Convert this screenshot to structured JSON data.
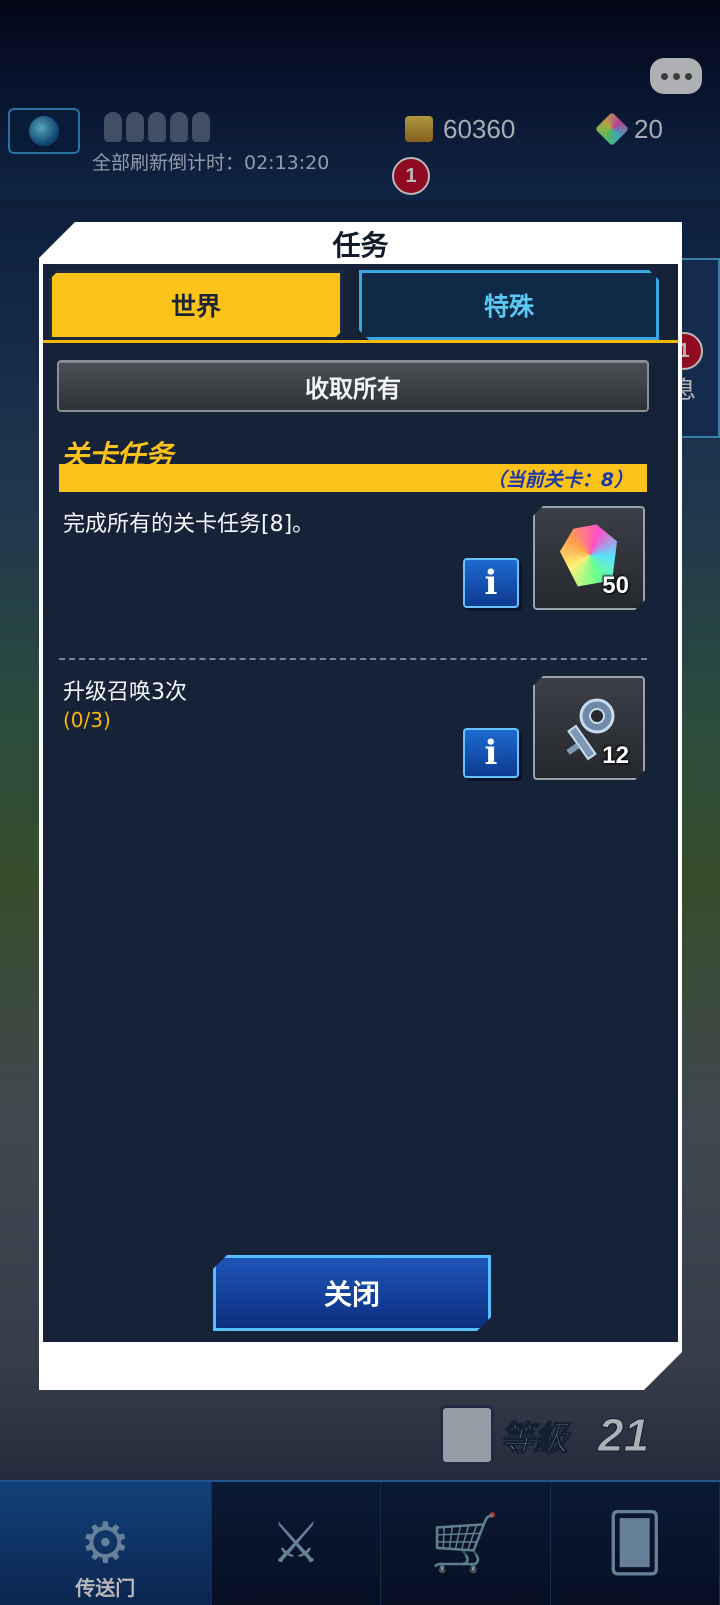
{
  "header": {
    "refresh_countdown": "全部刷新倒计时：02:13:20",
    "gold": "60360",
    "gems": "20",
    "notification_badge": "1",
    "side_badge": "1",
    "side_label": "息"
  },
  "modal": {
    "title": "任务",
    "tabs": [
      {
        "label": "世界",
        "active": true
      },
      {
        "label": "特殊",
        "active": false
      }
    ],
    "collect_all_label": "收取所有",
    "section": {
      "heading": "关卡任务",
      "current_stage": "（当前关卡：8）"
    },
    "quests": [
      {
        "title": "完成所有的关卡任务[8]。",
        "progress": "",
        "reward_icon": "rainbow-gem-icon",
        "reward_count": "50"
      },
      {
        "title": "升级召唤3次",
        "progress": "(0/3)",
        "reward_icon": "key-icon",
        "reward_count": "12"
      }
    ],
    "info_label": "i",
    "close_label": "关闭"
  },
  "hud": {
    "level_label": "等級",
    "level_value": "21"
  },
  "bottom_nav": [
    {
      "label": "传送门",
      "icon": "portal-icon"
    },
    {
      "label": "",
      "icon": "duel-swords-icon"
    },
    {
      "label": "",
      "icon": "shop-cart-icon"
    },
    {
      "label": "",
      "icon": "deck-cards-icon"
    }
  ],
  "colors": {
    "accent_yellow": "#fbc219",
    "modal_panel": "#152238",
    "accent_blue": "#56c0ff",
    "stage_text": "#1a36a8"
  }
}
